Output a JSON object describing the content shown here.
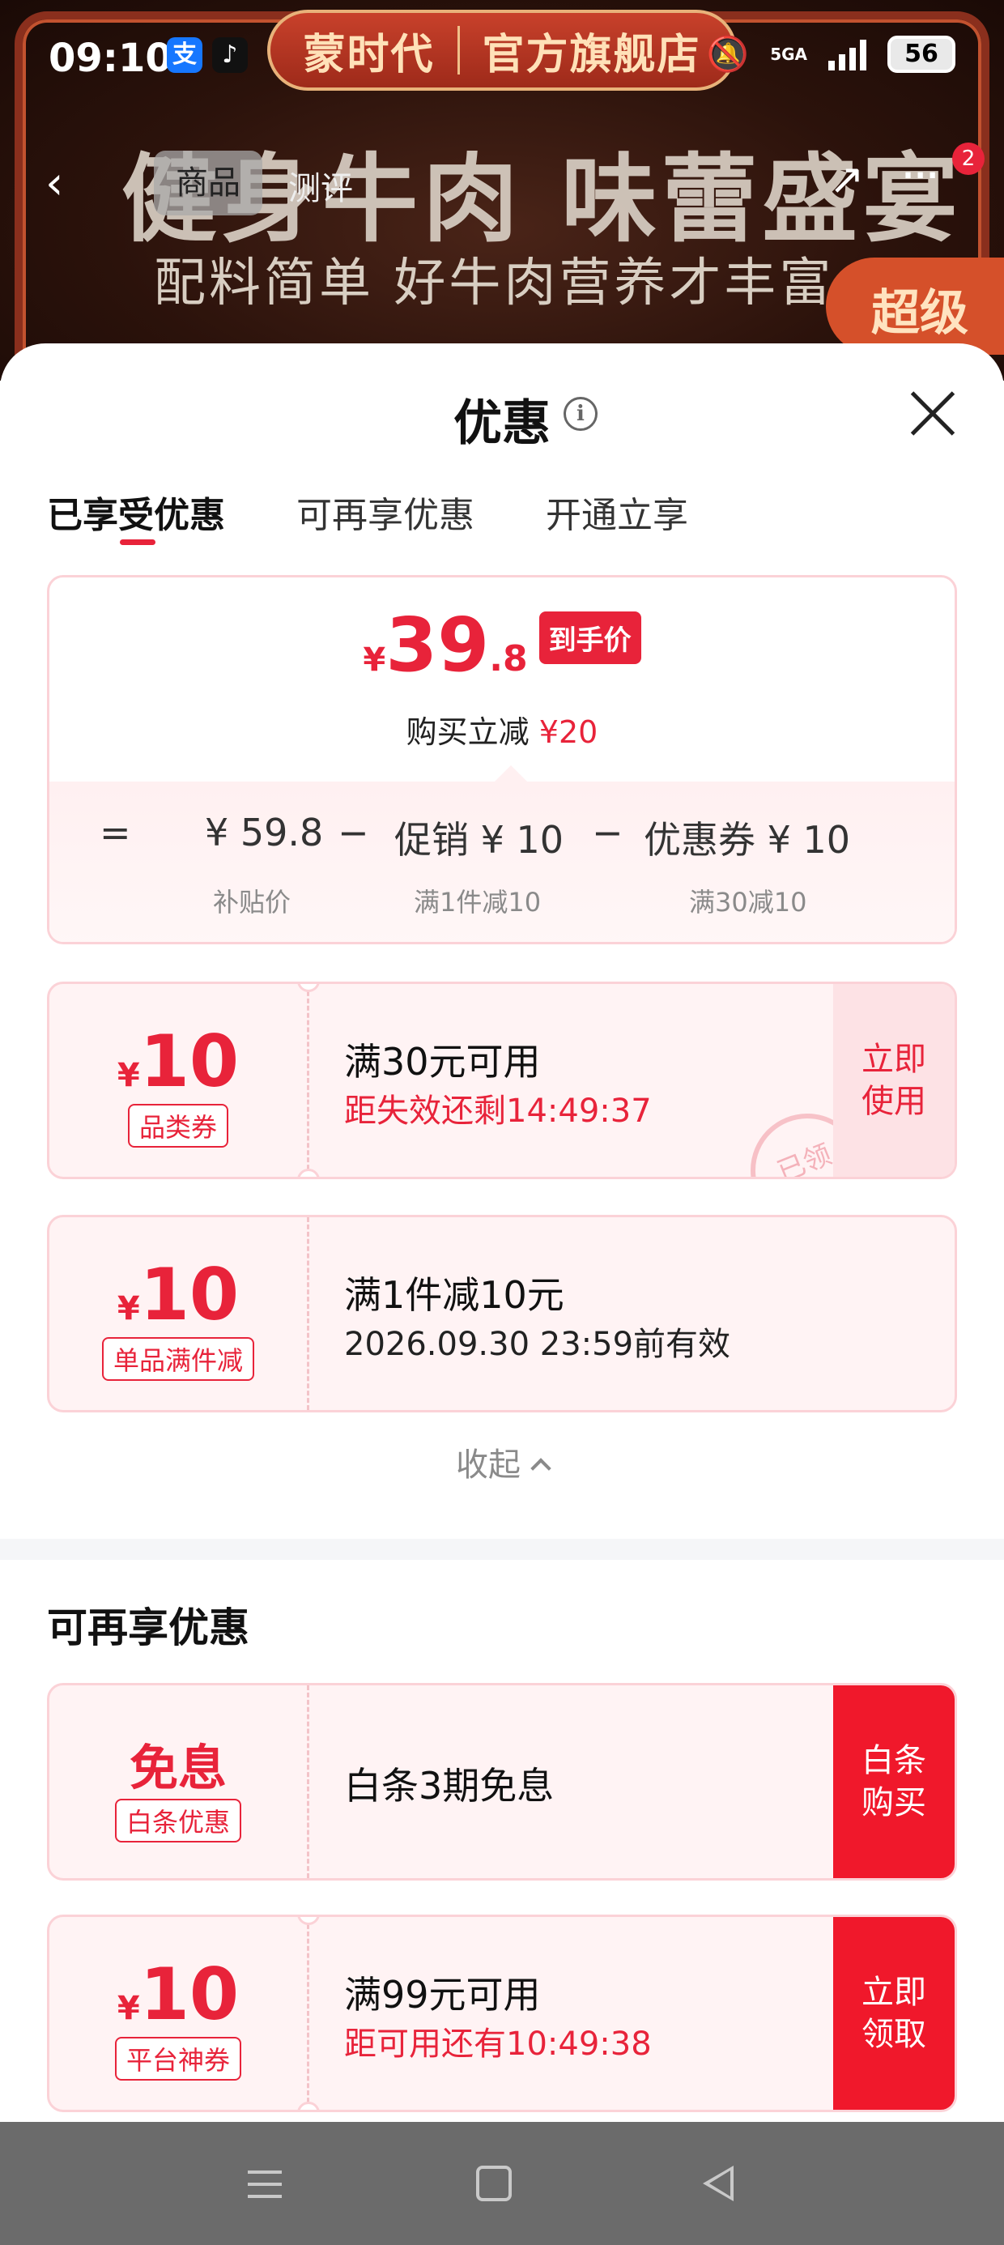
{
  "status_bar": {
    "time": "09:10",
    "alipay_icon": "支",
    "tiktok_icon": "♪",
    "network": "5GA",
    "battery": "56"
  },
  "product_page": {
    "brand_left": "蒙时代",
    "brand_right": "官方旗舰店",
    "headline": "健身牛肉 味蕾盛宴",
    "subline": "配料简单 好牛肉营养才丰富",
    "super_badge": "超级",
    "nav_tabs": [
      "商品",
      "测评"
    ],
    "cart_badge": "2"
  },
  "sheet": {
    "title": "优惠",
    "tabs": [
      "已享受优惠",
      "可再享优惠",
      "开通立享"
    ],
    "active_tab": "已享受优惠"
  },
  "summary": {
    "currency": "¥",
    "price_int": "39",
    "price_dec": ".8",
    "price_tag": "到手价",
    "reduce_label": "购买立减",
    "reduce_amount": "¥20",
    "calc": {
      "equals": "=",
      "base": "¥ 59.8",
      "base_label": "补贴价",
      "minus1": "−",
      "promo": "促销 ¥ 10",
      "promo_label": "满1件减10",
      "minus2": "−",
      "coupon": "优惠券 ¥ 10",
      "coupon_label": "满30减10"
    }
  },
  "coupons": [
    {
      "currency": "¥",
      "amount": "10",
      "type": "品类券",
      "title": "满30元可用",
      "subtitle": "距失效还剩14:49:37",
      "action": "立即使用",
      "stamp": "已领"
    },
    {
      "currency": "¥",
      "amount": "10",
      "type": "单品满件减",
      "title": "满1件减10元",
      "subtitle": "2026.09.30 23:59前有效"
    }
  ],
  "collapse_label": "收起",
  "more_section": {
    "title": "可再享优惠",
    "offers": [
      {
        "amount_text": "免息",
        "type": "白条优惠",
        "title": "白条3期免息",
        "action": "白条购买"
      },
      {
        "currency": "¥",
        "amount": "10",
        "type": "平台神券",
        "title": "满99元可用",
        "subtitle": "距可用还有10:49:38",
        "action": "立即领取"
      }
    ]
  },
  "colors": {
    "accent_red": "#e8233a",
    "button_red": "#f0182b",
    "card_bg": "#fff3f4",
    "nav_bar": "#6b6b6b"
  },
  "icons": [
    "alipay-icon",
    "tiktok-icon",
    "mute-bell-icon",
    "signal-icon",
    "battery-icon",
    "back-arrow-icon",
    "share-icon",
    "more-icon",
    "info-icon",
    "close-icon",
    "chevron-up-icon",
    "menu-icon",
    "home-icon",
    "back-triangle-icon"
  ]
}
